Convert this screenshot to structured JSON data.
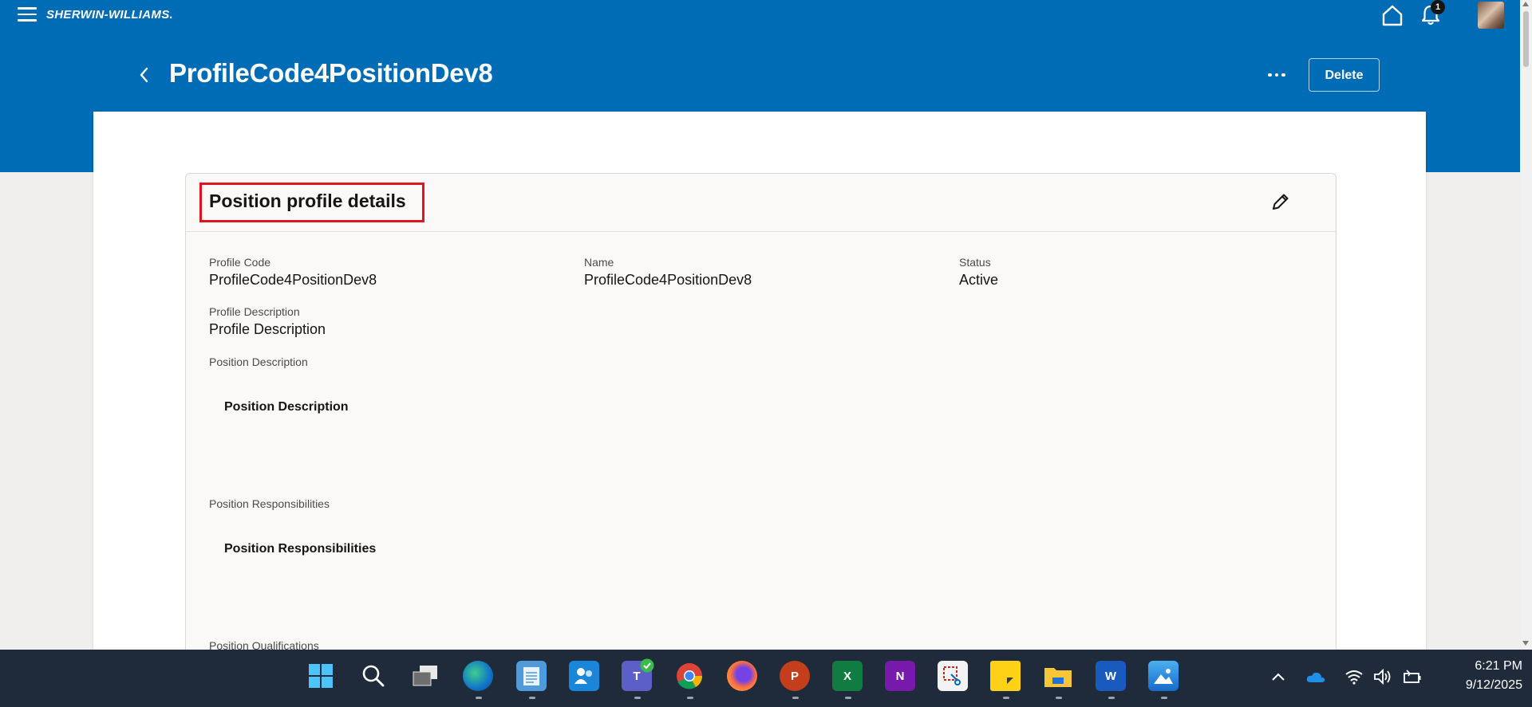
{
  "app": {
    "brand": "SHERWIN-WILLIAMS.",
    "notification_count": "1"
  },
  "page": {
    "title": "ProfileCode4PositionDev8",
    "delete_label": "Delete"
  },
  "card": {
    "title": "Position profile details",
    "fields": {
      "profile_code_label": "Profile Code",
      "profile_code_value": "ProfileCode4PositionDev8",
      "name_label": "Name",
      "name_value": "ProfileCode4PositionDev8",
      "status_label": "Status",
      "status_value": "Active",
      "profile_description_label": "Profile Description",
      "profile_description_value": "Profile Description",
      "position_description_label": "Position Description",
      "position_description_value": "Position Description",
      "position_responsibilities_label": "Position Responsibilities",
      "position_responsibilities_value": "Position Responsibilities",
      "position_qualifications_label": "Position Qualifications"
    }
  },
  "taskbar": {
    "apps": [
      "start",
      "search",
      "task-view",
      "edge",
      "notepad",
      "people",
      "teams",
      "chrome",
      "firefox",
      "powerpoint",
      "excel",
      "onenote",
      "snipping-tool",
      "sticky-notes",
      "file-explorer",
      "word",
      "photos"
    ],
    "clock_time": "6:21 PM",
    "clock_date": "9/12/2025"
  },
  "colors": {
    "header_blue": "#006cb5",
    "highlight_red": "#e1141f",
    "taskbar": "#1f2a3a"
  }
}
